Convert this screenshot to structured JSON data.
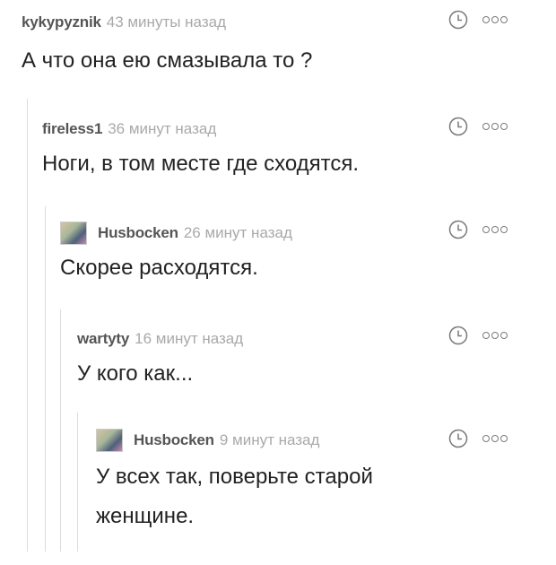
{
  "comments": [
    {
      "author": "kykypyznik",
      "time": "43 минуты назад",
      "text": "А что она ею смазывала то ?",
      "has_avatar": false,
      "clock_icon": "clock-icon",
      "more_icon": "more-dots-icon"
    },
    {
      "author": "fireless1",
      "time": "36 минут назад",
      "text": "Ноги, в том месте где сходятся.",
      "has_avatar": false,
      "clock_icon": "clock-icon",
      "more_icon": "more-dots-icon"
    },
    {
      "author": "Husbocken",
      "time": "26 минут назад",
      "text": "Скорее расходятся.",
      "has_avatar": true,
      "clock_icon": "clock-icon",
      "more_icon": "more-dots-icon"
    },
    {
      "author": "wartyty",
      "time": "16 минут назад",
      "text": "У кого как...",
      "has_avatar": false,
      "clock_icon": "clock-icon",
      "more_icon": "more-dots-icon"
    },
    {
      "author": "Husbocken",
      "time": "9 минут назад",
      "text": "У всех так, поверьте старой женщине.",
      "has_avatar": true,
      "clock_icon": "clock-icon",
      "more_icon": "more-dots-icon"
    }
  ],
  "colors": {
    "author": "#555555",
    "time": "#a9a9a9",
    "text": "#222222",
    "thread_line": "#dcdcdc",
    "icon": "#7a7a7a"
  }
}
